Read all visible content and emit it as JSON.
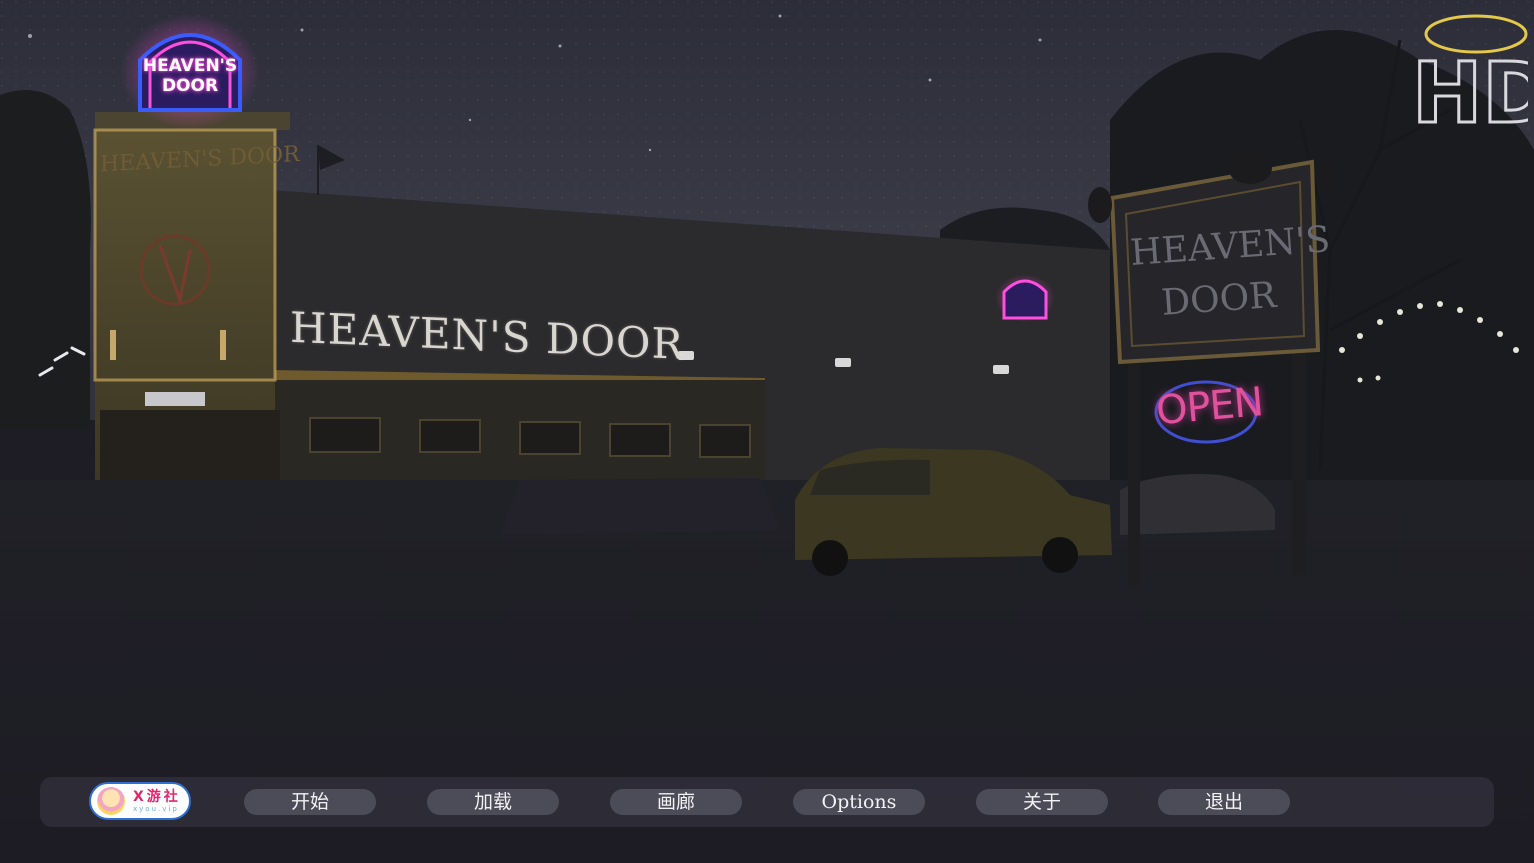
{
  "scene": {
    "roof_sign_lines": [
      "HEAVEN'S",
      "DOOR"
    ],
    "tower_sign": "HEAVEN'S DOOR",
    "building_sign": "HEAVEN'S DOOR",
    "board_sign_lines": [
      "HEAVEN'S",
      "DOOR"
    ],
    "open_sign": "OPEN",
    "hd_logo": "HD"
  },
  "menu": {
    "badge": {
      "title": "X游社",
      "subtitle": "xyou.vip"
    },
    "start": "开始",
    "load": "加载",
    "gallery": "画廊",
    "options": "Options",
    "about": "关于",
    "quit": "退出"
  },
  "colors": {
    "sky": "#2a2b36",
    "ground": "#1c1b22",
    "menu_bar": "#2e2d38",
    "button": "#4c4b58",
    "neon_pink": "#ff4ee0",
    "neon_blue": "#3a5cff",
    "warm_light": "#c9a85a"
  }
}
